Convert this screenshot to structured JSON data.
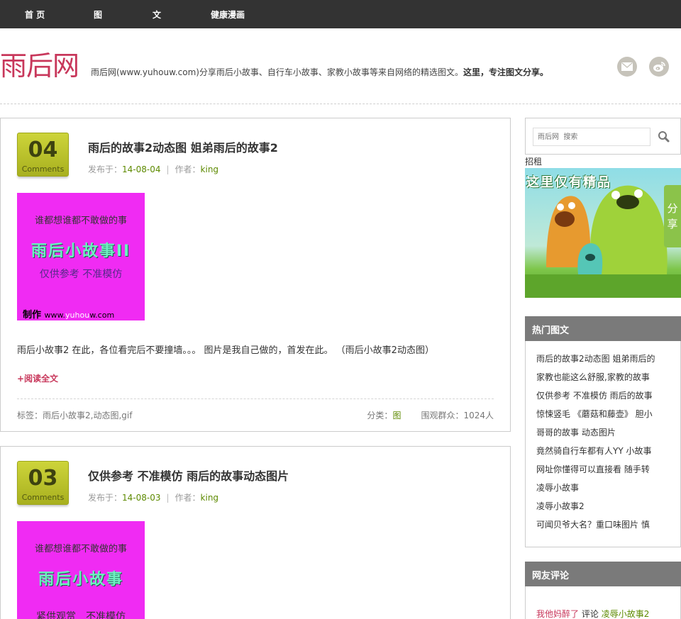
{
  "nav": {
    "items": [
      "首 页",
      "图",
      "文",
      "健康漫画"
    ]
  },
  "header": {
    "logo": "雨后网",
    "tagline_main": "雨后网(www.yuhouw.com)分享雨后小故事、自行车小故事、家教小故事等来自网络的精选图文。",
    "tagline_bold": "这里，专注图文分享。",
    "icons": [
      "mail-icon",
      "weibo-icon"
    ]
  },
  "posts": [
    {
      "day": "04",
      "comments_label": "Comments",
      "title": "雨后的故事2动态图 姐弟雨后的故事2",
      "published_label": "发布于：",
      "date": "14-08-04",
      "author_label": "作者：",
      "author": "king",
      "thumb": {
        "line1": "谁都想谁都不敢做的事",
        "line2": "雨后小故事II",
        "line3": "仅供参考 不准模仿",
        "line4_a": "制作",
        "line4_b": "www.",
        "line4_c": "yuhou",
        "line4_d": "w.com"
      },
      "excerpt": "雨后小故事2 在此，各位看完后不要撞墙。。。 图片是我自己做的，首发在此。 （雨后小故事2动态图）",
      "readmore": "+阅读全文",
      "tags": "标签：雨后小故事2,动态图,gif",
      "category_label": "分类：",
      "category": "图",
      "views": "围观群众：1024人"
    },
    {
      "day": "03",
      "comments_label": "Comments",
      "title": "仅供参考 不准模仿 雨后的故事动态图片",
      "published_label": "发布于：",
      "date": "14-08-03",
      "author_label": "作者：",
      "author": "king",
      "thumb": {
        "line1": "谁都想谁都不敢做的事",
        "line2": "雨后小故事",
        "line3": "紧供观赏　不准模仿"
      }
    }
  ],
  "sidebar": {
    "search_placeholder": "雨后网  搜索",
    "ad_label": "招租",
    "ad_text": "这里仅有精品",
    "share_tab": [
      "分",
      "享"
    ],
    "hot": {
      "title": "热门图文",
      "items": [
        "雨后的故事2动态图 姐弟雨后的",
        "家教也能这么舒服,家教的故事",
        "仅供参考 不准模仿 雨后的故事",
        "惊悚竖毛 《蘑菇和藤壶》 胆小",
        "哥哥的故事 动态图片",
        "竟然骑自行车都有人YY 小故事",
        "网址你懂得可以直接看 随手转",
        "凌辱小故事",
        "凌辱小故事2",
        "可闻贝爷大名？重口味图片 慎"
      ]
    },
    "comments": {
      "title": "网友评论",
      "user": "我他妈醉了",
      "verb": "评论",
      "target": "凌辱小故事2"
    }
  }
}
